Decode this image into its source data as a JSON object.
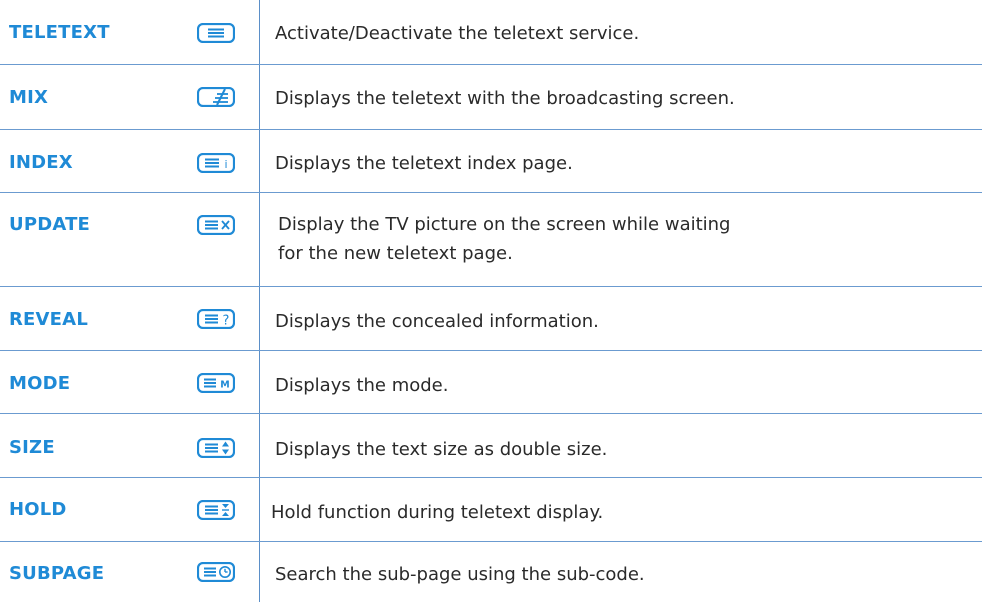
{
  "rows": [
    {
      "name": "TELETEXT",
      "icon": "teletext-icon",
      "desc": [
        "Activate/Deactivate the teletext service."
      ]
    },
    {
      "name": "MIX",
      "icon": "mix-icon",
      "desc": [
        "Displays the teletext with the broadcasting screen."
      ]
    },
    {
      "name": "INDEX",
      "icon": "index-icon",
      "desc": [
        "Displays the teletext index page."
      ]
    },
    {
      "name": "UPDATE",
      "icon": "update-icon",
      "desc": [
        "Display the TV picture on the screen while waiting",
        "for the new teletext page."
      ]
    },
    {
      "name": "REVEAL",
      "icon": "reveal-icon",
      "desc": [
        "Displays the concealed information."
      ]
    },
    {
      "name": "MODE",
      "icon": "mode-icon",
      "desc": [
        "Displays the mode."
      ]
    },
    {
      "name": "SIZE",
      "icon": "size-icon",
      "desc": [
        "Displays the text size as double size."
      ]
    },
    {
      "name": "HOLD",
      "icon": "hold-icon",
      "desc": [
        "Hold function during teletext display."
      ]
    },
    {
      "name": "SUBPAGE",
      "icon": "subpage-icon",
      "desc": [
        "Search the sub-page using the sub-code."
      ]
    }
  ],
  "colors": {
    "accent": "#1f8ad6",
    "rule": "#6b9bd0",
    "text": "#2a2a2a"
  }
}
